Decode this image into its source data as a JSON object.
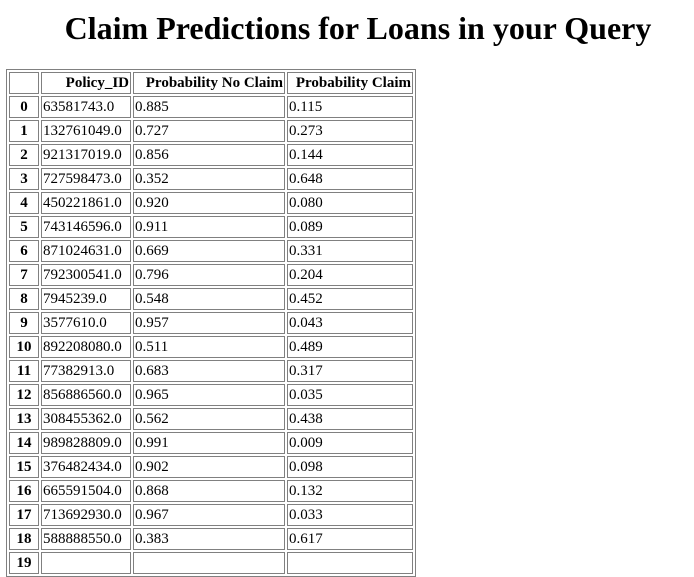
{
  "page": {
    "title": "Claim Predictions for Loans in your Query"
  },
  "table": {
    "columns": [
      "",
      "Policy_ID",
      "Probability No Claim",
      "Probability Claim"
    ],
    "rows": [
      {
        "index": "0",
        "policy_id": "63581743.0",
        "prob_no_claim": "0.885",
        "prob_claim": "0.115"
      },
      {
        "index": "1",
        "policy_id": "132761049.0",
        "prob_no_claim": "0.727",
        "prob_claim": "0.273"
      },
      {
        "index": "2",
        "policy_id": "921317019.0",
        "prob_no_claim": "0.856",
        "prob_claim": "0.144"
      },
      {
        "index": "3",
        "policy_id": "727598473.0",
        "prob_no_claim": "0.352",
        "prob_claim": "0.648"
      },
      {
        "index": "4",
        "policy_id": "450221861.0",
        "prob_no_claim": "0.920",
        "prob_claim": "0.080"
      },
      {
        "index": "5",
        "policy_id": "743146596.0",
        "prob_no_claim": "0.911",
        "prob_claim": "0.089"
      },
      {
        "index": "6",
        "policy_id": "871024631.0",
        "prob_no_claim": "0.669",
        "prob_claim": "0.331"
      },
      {
        "index": "7",
        "policy_id": "792300541.0",
        "prob_no_claim": "0.796",
        "prob_claim": "0.204"
      },
      {
        "index": "8",
        "policy_id": "7945239.0",
        "prob_no_claim": "0.548",
        "prob_claim": "0.452"
      },
      {
        "index": "9",
        "policy_id": "3577610.0",
        "prob_no_claim": "0.957",
        "prob_claim": "0.043"
      },
      {
        "index": "10",
        "policy_id": "892208080.0",
        "prob_no_claim": "0.511",
        "prob_claim": "0.489"
      },
      {
        "index": "11",
        "policy_id": "77382913.0",
        "prob_no_claim": "0.683",
        "prob_claim": "0.317"
      },
      {
        "index": "12",
        "policy_id": "856886560.0",
        "prob_no_claim": "0.965",
        "prob_claim": "0.035"
      },
      {
        "index": "13",
        "policy_id": "308455362.0",
        "prob_no_claim": "0.562",
        "prob_claim": "0.438"
      },
      {
        "index": "14",
        "policy_id": "989828809.0",
        "prob_no_claim": "0.991",
        "prob_claim": "0.009"
      },
      {
        "index": "15",
        "policy_id": "376482434.0",
        "prob_no_claim": "0.902",
        "prob_claim": "0.098"
      },
      {
        "index": "16",
        "policy_id": "665591504.0",
        "prob_no_claim": "0.868",
        "prob_claim": "0.132"
      },
      {
        "index": "17",
        "policy_id": "713692930.0",
        "prob_no_claim": "0.967",
        "prob_claim": "0.033"
      },
      {
        "index": "18",
        "policy_id": "588888550.0",
        "prob_no_claim": "0.383",
        "prob_claim": "0.617"
      },
      {
        "index": "19",
        "policy_id": "",
        "prob_no_claim": "",
        "prob_claim": ""
      }
    ]
  }
}
